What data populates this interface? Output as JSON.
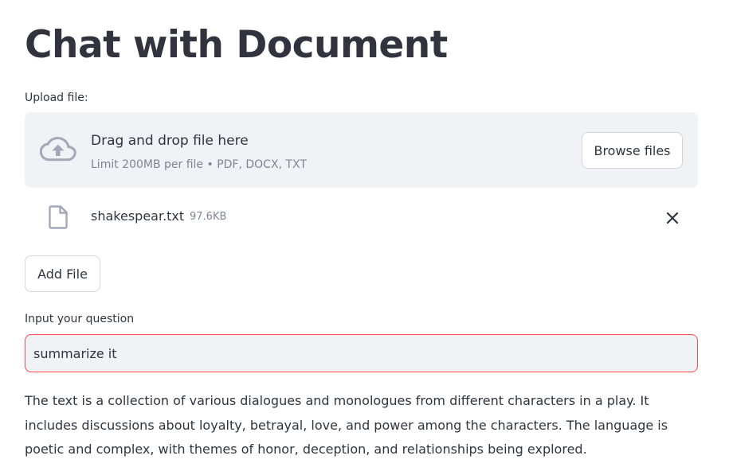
{
  "header": {
    "title": "Chat with Document"
  },
  "uploader": {
    "label": "Upload file:",
    "drop_title": "Drag and drop file here",
    "drop_hint": "Limit 200MB per file • PDF, DOCX, TXT",
    "browse_label": "Browse files",
    "icon": "cloud-upload-icon"
  },
  "uploaded_file": {
    "name": "shakespear.txt",
    "size": "97.6KB",
    "icon": "file-icon",
    "remove_icon": "close-icon"
  },
  "add_file": {
    "label": "Add File"
  },
  "question": {
    "label": "Input your question",
    "value": "summarize it"
  },
  "answer": {
    "text": "The text is a collection of various dialogues and monologues from different characters in a play. It includes discussions about loyalty, betrayal, love, and power among the characters. The language is poetic and complex, with themes of honor, deception, and relationships being explored."
  },
  "colors": {
    "text": "#31333f",
    "muted": "#808495",
    "dropzone_bg": "#f0f2f6",
    "input_border_focus": "#ff4b4b"
  }
}
